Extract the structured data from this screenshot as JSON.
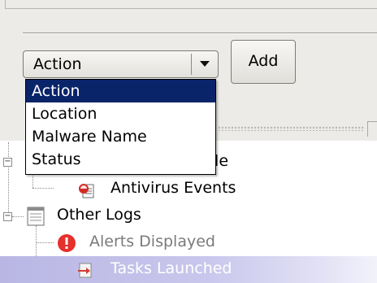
{
  "toolbar": {
    "filter_combo": {
      "selected": "Action"
    },
    "add_label": "Add"
  },
  "dropdown": {
    "options": [
      "Action",
      "Location",
      "Malware Name",
      "Status"
    ],
    "highlighted": "Action"
  },
  "tree": {
    "partial_parent_label": "ule",
    "antivirus_events_label": "Antivirus Events",
    "other_logs_label": "Other Logs",
    "alerts_displayed_label": "Alerts Displayed",
    "tasks_launched_label": "Tasks Launched"
  },
  "colors": {
    "dropdown_highlight": "#0a246a",
    "selection_row": "#b9b6e4",
    "alert_red": "#e5302b"
  },
  "icons": {
    "combo_arrow": "chevron-down-icon",
    "antivirus_events": "antivirus-events-icon",
    "other_logs": "log-file-icon",
    "alerts_displayed": "alert-icon",
    "tasks_launched": "task-launch-icon"
  }
}
